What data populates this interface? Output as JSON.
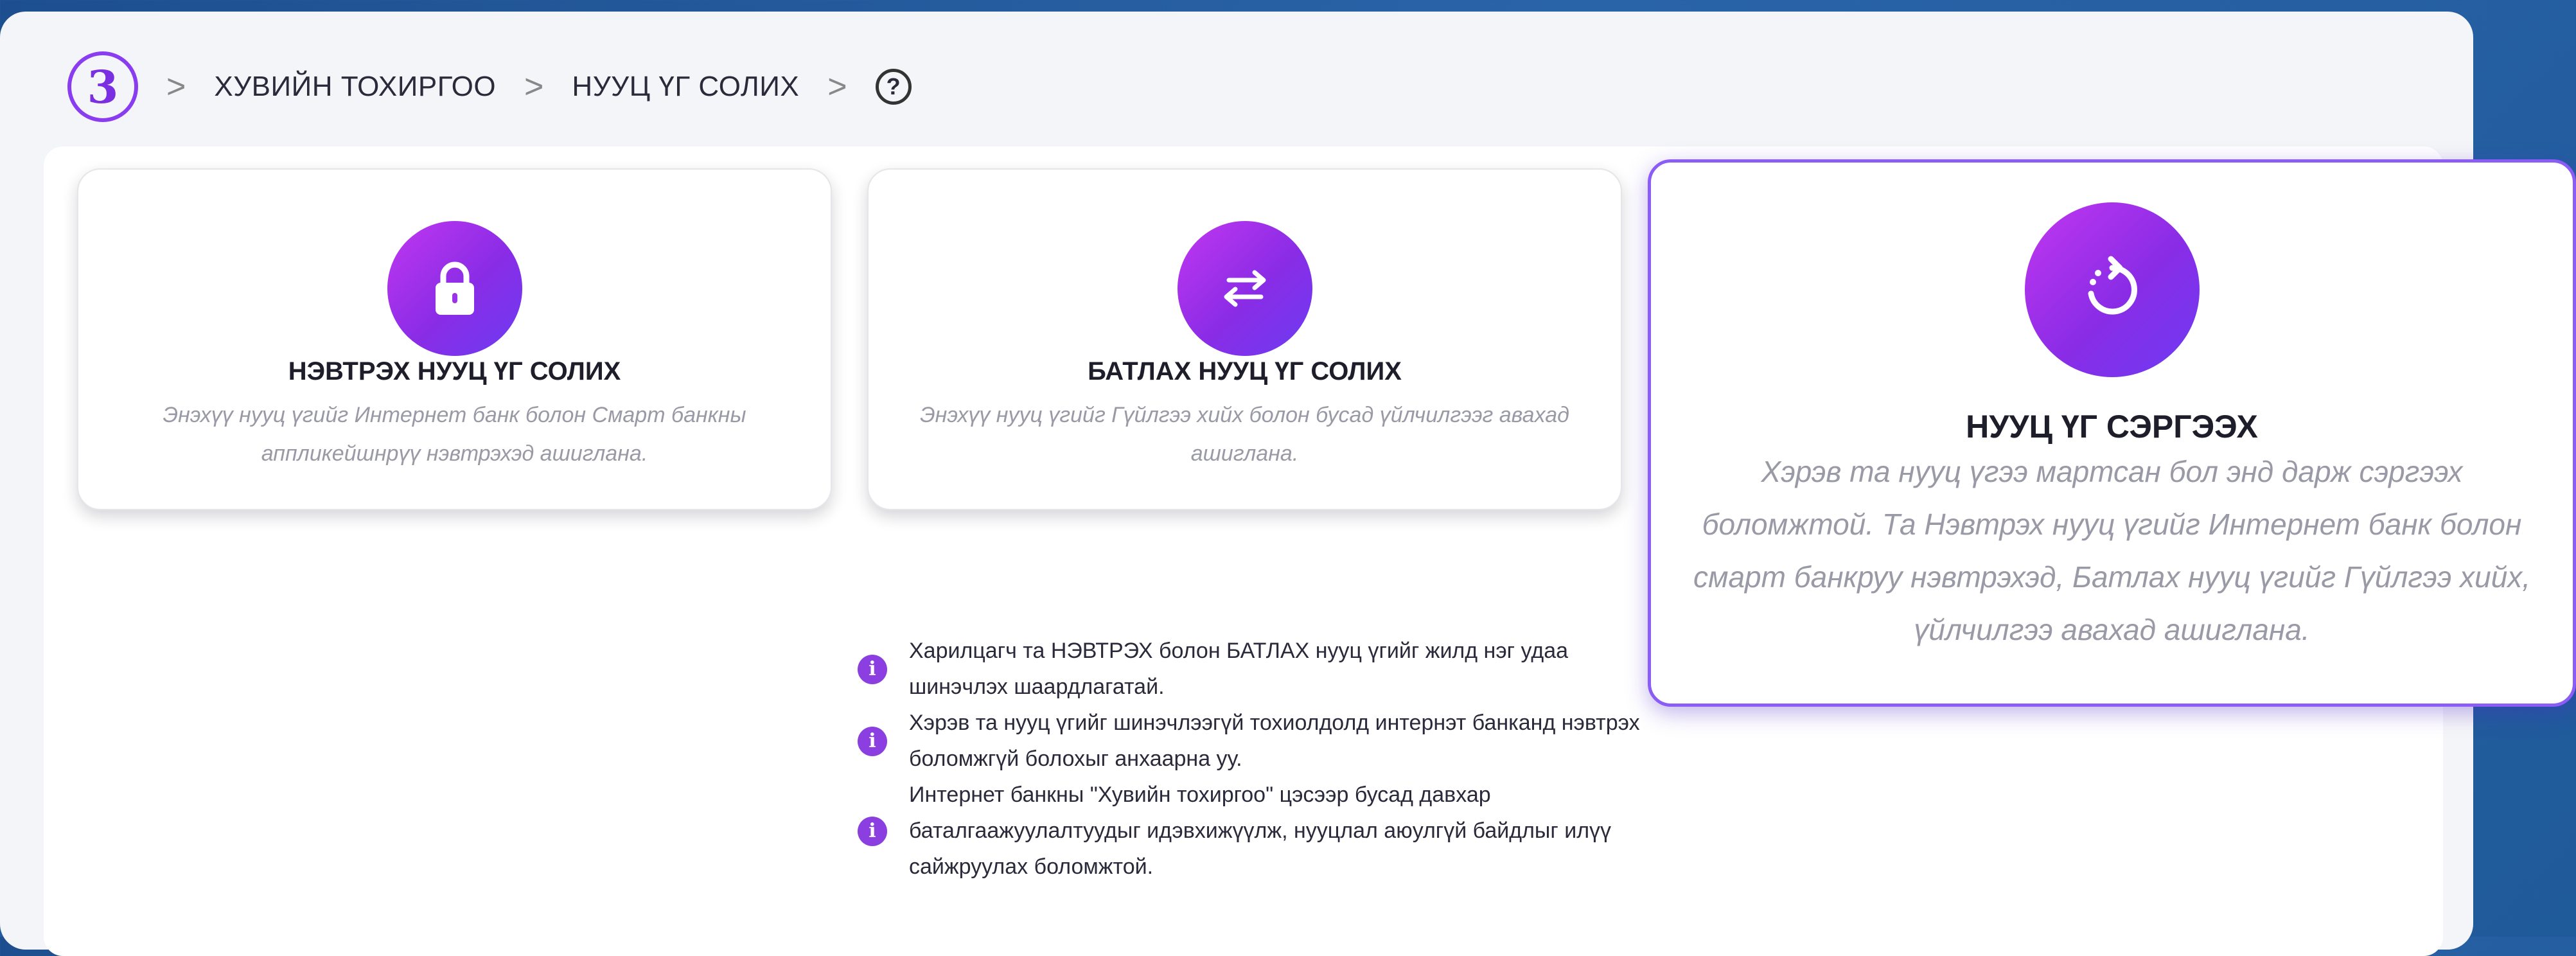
{
  "breadcrumb": {
    "step_number": "3",
    "items": [
      "ХУВИЙН ТОХИРГОО",
      "НУУЦ ҮГ СОЛИХ"
    ],
    "separator": ">",
    "help_symbol": "?"
  },
  "cards": [
    {
      "icon": "lock-icon",
      "title": "НЭВТРЭХ НУУЦ ҮГ СОЛИХ",
      "description": "Энэхүү нууц үгийг Интернет банк болон Смарт банкны аппликейшнрүү нэвтрэхэд ашиглана."
    },
    {
      "icon": "swap-arrows-icon",
      "title": "БАТЛАХ НУУЦ ҮГ СОЛИХ",
      "description": "Энэхүү нууц үгийг Гүйлгээ хийх болон бусад үйлчилгээг авахад ашиглана."
    },
    {
      "icon": "reset-icon",
      "title": "НУУЦ ҮГ СЭРГЭЭХ",
      "description": "Хэрэв та нууц үгээ мартсан бол энд дарж сэргээх боломжтой. Та Нэвтрэх нууц үгийг Интернет банк болон смарт банкруу нэвтрэхэд, Батлах нууц үгийг Гүйлгээ хийх, үйлчилгээ авахад ашиглана."
    }
  ],
  "notes": [
    "Харилцагч та НЭВТРЭХ болон БАТЛАХ нууц үгийг жилд нэг удаа шинэчлэх шаардлагатай.",
    "Хэрэв та нууц үгийг шинэчлээгүй тохиолдолд интернэт банканд нэвтрэх боломжгүй болохыг анхаарна уу.",
    "Интернет банкны \"Хувийн тохиргоо\" цэсээр бусад давхар баталгаажуулалтуудыг идэвхижүүлж, нууцлал аюулгүй байдлыг илүү сайжруулах боломжтой."
  ],
  "info_symbol": "i",
  "colors": {
    "accent": "#8a2ce6",
    "accent_light": "#c237f0",
    "highlight_border": "#8b5cf6",
    "background": "#1f5a9a"
  }
}
